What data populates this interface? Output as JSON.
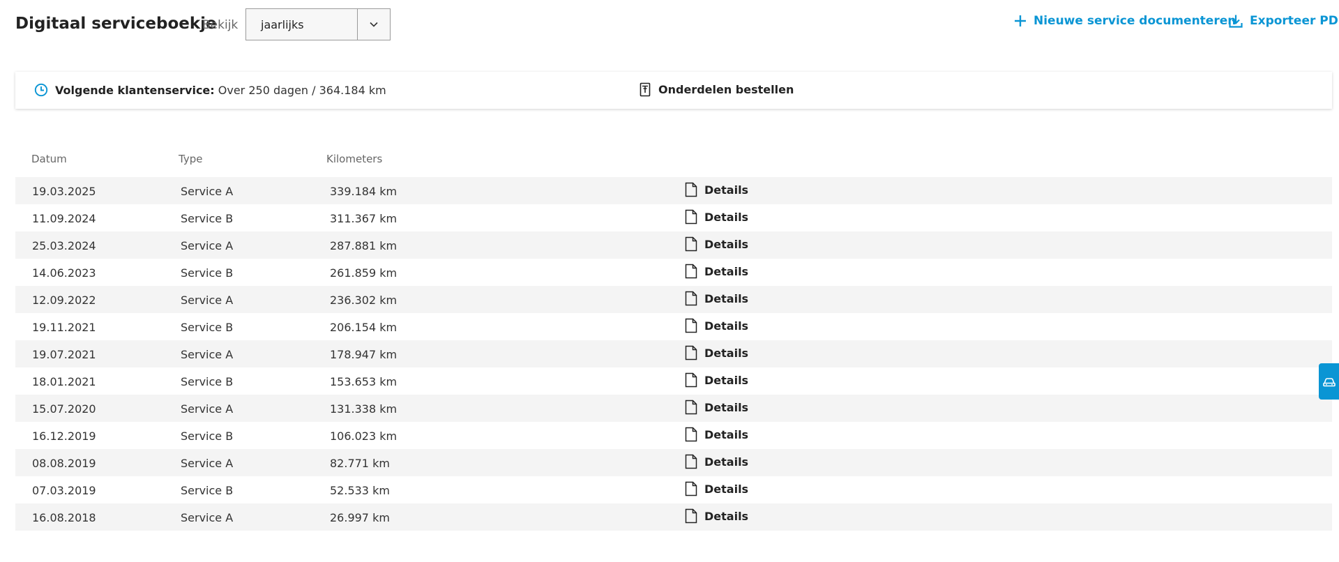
{
  "header": {
    "title": "Digitaal serviceboekje",
    "view_label": "Bekijk",
    "view_select": {
      "value": "jaarlijks"
    },
    "actions": {
      "new_service": "Nieuwe service documenteren",
      "export_pdf": "Exporteer PDF"
    },
    "accent_color": "#0a95d4"
  },
  "info_card": {
    "next_service_label": "Volgende klantenservice:",
    "next_service_value": "Over 250 dagen / 364.184 km",
    "order_parts": "Onderdelen bestellen"
  },
  "table": {
    "columns": [
      "Datum",
      "Type",
      "Kilometers"
    ],
    "details_label": "Details",
    "rows": [
      {
        "date": "19.03.2025",
        "type": "Service A",
        "km": "339.184 km"
      },
      {
        "date": "11.09.2024",
        "type": "Service B",
        "km": "311.367 km"
      },
      {
        "date": "25.03.2024",
        "type": "Service A",
        "km": "287.881 km"
      },
      {
        "date": "14.06.2023",
        "type": "Service B",
        "km": "261.859 km"
      },
      {
        "date": "12.09.2022",
        "type": "Service A",
        "km": "236.302 km"
      },
      {
        "date": "19.11.2021",
        "type": "Service B",
        "km": "206.154 km"
      },
      {
        "date": "19.07.2021",
        "type": "Service A",
        "km": "178.947 km"
      },
      {
        "date": "18.01.2021",
        "type": "Service B",
        "km": "153.653 km"
      },
      {
        "date": "15.07.2020",
        "type": "Service A",
        "km": "131.338 km"
      },
      {
        "date": "16.12.2019",
        "type": "Service B",
        "km": "106.023 km"
      },
      {
        "date": "08.08.2019",
        "type": "Service A",
        "km": "82.771 km"
      },
      {
        "date": "07.03.2019",
        "type": "Service B",
        "km": "52.533 km"
      },
      {
        "date": "16.08.2018",
        "type": "Service A",
        "km": "26.997 km"
      }
    ]
  },
  "icons": {
    "new_service": "plus-icon",
    "export_pdf": "download-icon",
    "next_service": "clock-icon",
    "order_parts": "parts-order-icon",
    "details": "document-icon",
    "select_toggle": "chevron-down-icon",
    "side_tab": "car-service-icon"
  }
}
